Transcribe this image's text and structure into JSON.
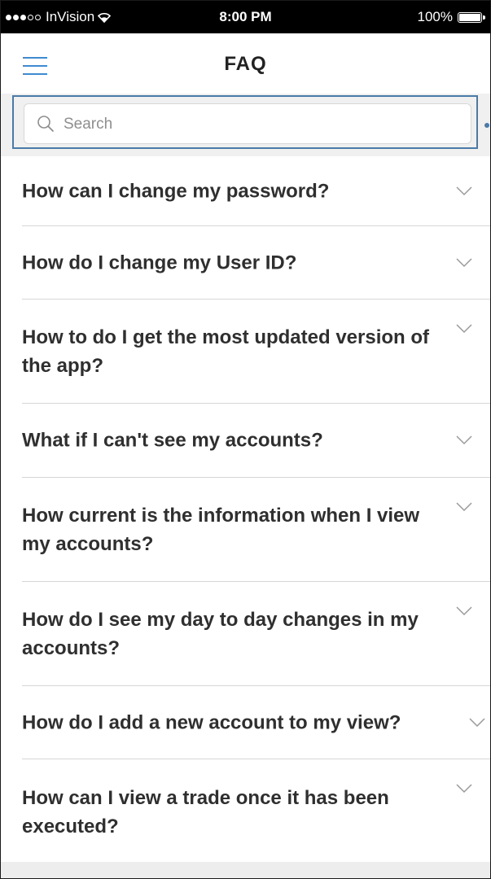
{
  "status_bar": {
    "carrier": "InVision",
    "time": "8:00 PM",
    "battery": "100%"
  },
  "header": {
    "title": "FAQ",
    "menu_icon": "hamburger-menu-icon"
  },
  "search": {
    "placeholder": "Search",
    "value": "",
    "icon": "search-icon"
  },
  "faq": {
    "items": [
      {
        "question": "How can I change my password?"
      },
      {
        "question": "How do I change my User ID?"
      },
      {
        "question": "How to do I get the most updated version of the app?"
      },
      {
        "question": "What if I can't see my accounts?"
      },
      {
        "question": "How current is the information when I view my accounts?"
      },
      {
        "question": "How do I see my day to day changes in my accounts?"
      },
      {
        "question": "How do I add a new account to my view?"
      },
      {
        "question": "How can I view a trade once it has been executed?"
      }
    ]
  },
  "colors": {
    "accent": "#3f8ad0",
    "highlight_border": "#4a7aa8",
    "text": "#2f2f2f",
    "divider": "#d6d6d6"
  }
}
